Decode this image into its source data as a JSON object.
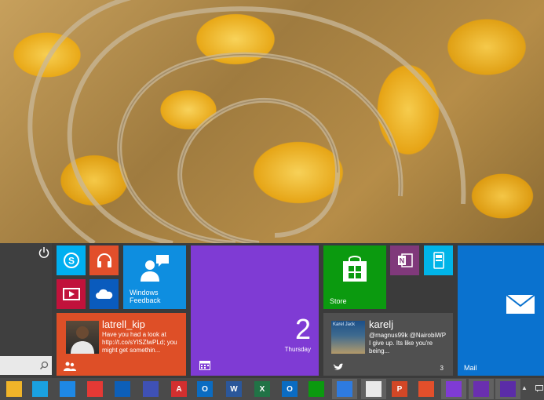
{
  "start": {
    "tiles": {
      "skype_icon": "skype-icon",
      "music_icon": "headphones-icon",
      "video_icon": "video-icon",
      "onedrive_icon": "cloud-icon",
      "feedback": {
        "label_line1": "Windows",
        "label_line2": "Feedback"
      },
      "people": {
        "name": "latrell_kip",
        "text": "Have you had a look at http://t.co/sYlSZlwPLd; you might get somethin..."
      },
      "calendar": {
        "number": "2",
        "day": "Thursday"
      },
      "store": {
        "label": "Store"
      },
      "twitter": {
        "image_label": "Karel Jack",
        "name": "karelj",
        "text": "@magnus99k @NairobiWP I give up. Its like you're being...",
        "count": "3"
      },
      "mail": {
        "label": "Mail"
      }
    }
  },
  "taskbar": {
    "items": [
      {
        "name": "file-explorer-icon",
        "bg": "#f0b429"
      },
      {
        "name": "settings-icon",
        "bg": "#1aa1e0"
      },
      {
        "name": "internet-explorer-icon",
        "bg": "#1e88e5"
      },
      {
        "name": "chrome-icon",
        "bg": "#e53935"
      },
      {
        "name": "app-icon",
        "bg": "#0d5fb8"
      },
      {
        "name": "calculator-icon",
        "bg": "#3f51b5"
      },
      {
        "name": "pdf-icon",
        "bg": "#d32f2f",
        "text": "A"
      },
      {
        "name": "outlook-icon",
        "bg": "#0a6cc2",
        "text": "O"
      },
      {
        "name": "word-icon",
        "bg": "#2b579a",
        "text": "W"
      },
      {
        "name": "excel-icon",
        "bg": "#217346",
        "text": "X"
      },
      {
        "name": "lync-icon",
        "bg": "#0a6cc2",
        "text": "O"
      },
      {
        "name": "store-icon",
        "bg": "#0b9a0f"
      },
      {
        "name": "weather-icon",
        "bg": "#2e7be0"
      },
      {
        "name": "people-icon",
        "bg": "#e9e9e9"
      },
      {
        "name": "powerpoint-icon",
        "bg": "#d24726",
        "text": "P"
      },
      {
        "name": "music-icon",
        "bg": "#e24f2b"
      },
      {
        "name": "calendar-icon",
        "bg": "#7f3bd4"
      },
      {
        "name": "search-icon",
        "bg": "#6a2fb0"
      },
      {
        "name": "gear-icon",
        "bg": "#5b2ca8"
      }
    ]
  }
}
